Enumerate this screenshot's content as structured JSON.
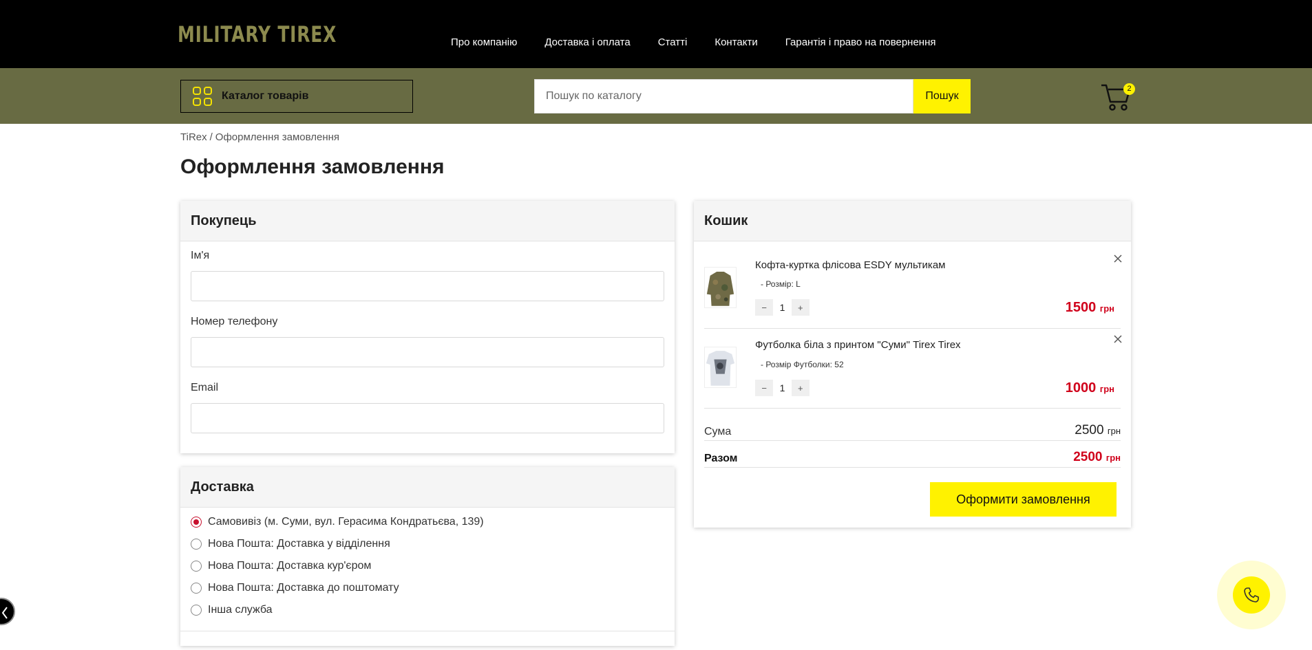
{
  "header": {
    "logo_text": "MILITARY  TIREX",
    "nav": [
      {
        "label": "Про компанію"
      },
      {
        "label": "Доставка і оплата"
      },
      {
        "label": "Статті"
      },
      {
        "label": "Контакти"
      },
      {
        "label": "Гарантія і право на повернення"
      }
    ]
  },
  "toolbar": {
    "catalog_label": "Каталог товарів",
    "search_placeholder": "Пошук по каталогу",
    "search_button": "Пошук",
    "cart_count": "2",
    "accent_color": "#fff200",
    "bar_color": "#686b43"
  },
  "breadcrumb": {
    "home": "TiRex",
    "separator": "/",
    "current": "Оформлення замовлення"
  },
  "page": {
    "title": "Оформлення замовлення"
  },
  "buyer": {
    "title": "Покупець",
    "fields": [
      {
        "label": "Ім'я",
        "value": ""
      },
      {
        "label": "Номер телефону",
        "value": ""
      },
      {
        "label": "Email",
        "value": ""
      }
    ]
  },
  "delivery": {
    "title": "Доставка",
    "options": [
      {
        "label": "Самовивіз (м. Суми, вул. Герасима Кондратьєва, 139)",
        "checked": true
      },
      {
        "label": "Нова Пошта: Доставка у відділення",
        "checked": false
      },
      {
        "label": "Нова Пошта: Доставка кур'єром",
        "checked": false
      },
      {
        "label": "Нова Пошта: Доставка до поштомату",
        "checked": false
      },
      {
        "label": "Інша служба",
        "checked": false
      }
    ]
  },
  "cart": {
    "title": "Кошик",
    "items": [
      {
        "name": "Кофта-куртка флісова ESDY мультикам",
        "option": "- Розмір: L",
        "qty": "1",
        "price": "1500",
        "currency": "грн"
      },
      {
        "name": "Футболка біла з принтом \"Суми\" Tirex Tirex",
        "option": "- Розмір Футболки: 52",
        "qty": "1",
        "price": "1000",
        "currency": "грн"
      }
    ],
    "sum_label": "Сума",
    "sum_value": "2500",
    "total_label": "Разом",
    "total_value": "2500",
    "currency": "грн",
    "order_button": "Оформити замовлення"
  }
}
